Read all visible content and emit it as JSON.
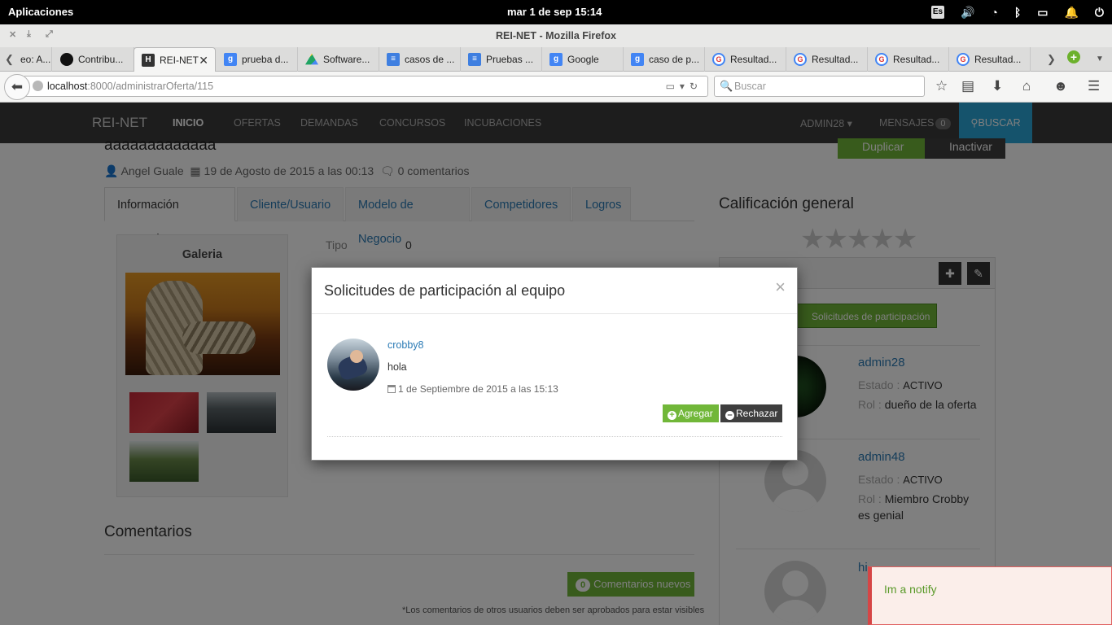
{
  "gnome": {
    "apps_label": "Aplicaciones",
    "clock": "mar  1 de sep    15:14",
    "lang": "Es"
  },
  "firefox": {
    "window_title": "REI-NET - Mozilla Firefox",
    "tabs": [
      {
        "label": "eo: A...",
        "icon": "tab-partial"
      },
      {
        "label": "Contribu...",
        "icon": "github-icon"
      },
      {
        "label": "REI-NET",
        "icon": "reinet-icon",
        "active": true
      },
      {
        "label": "prueba d...",
        "icon": "google-icon"
      },
      {
        "label": "Software...",
        "icon": "drive-icon"
      },
      {
        "label": "casos de ...",
        "icon": "docs-icon"
      },
      {
        "label": "Pruebas ...",
        "icon": "docs-icon"
      },
      {
        "label": "Google",
        "icon": "google-icon"
      },
      {
        "label": "caso de p...",
        "icon": "google-icon"
      },
      {
        "label": "Resultad...",
        "icon": "google-color-icon"
      },
      {
        "label": "Resultad...",
        "icon": "google-color-icon"
      },
      {
        "label": "Resultad...",
        "icon": "google-color-icon"
      },
      {
        "label": "Resultad...",
        "icon": "google-color-icon"
      }
    ],
    "url_host": "localhost",
    "url_rest": ":8000/administrarOferta/115",
    "search_placeholder": "Buscar"
  },
  "navbar": {
    "brand": "REI-NET",
    "links": [
      "INICIO",
      "OFERTAS",
      "DEMANDAS",
      "CONCURSOS",
      "INCUBACIONES"
    ],
    "user": "ADMIN28",
    "mensajes": "MENSAJES",
    "mensajes_count": "0",
    "buscar": "BUSCAR"
  },
  "offer": {
    "title": "aaaaaaaaaaaaa",
    "author": "Angel Guale",
    "date": "19 de Agosto de 2015 a las 00:13",
    "comments_count": "0 comentarios",
    "duplicar": "Duplicar",
    "inactivar": "Inactivar",
    "tabs": [
      "Información General",
      "Cliente/Usuario",
      "Modelo de Negocio",
      "Competidores",
      "Logros"
    ],
    "gallery_title": "Galeria",
    "tipo_label": "Tipo",
    "tipo_value": "0",
    "comentarios_title": "Comentarios",
    "comentarios_nuevos_count": "0",
    "comentarios_nuevos": "Comentarios nuevos",
    "comentarios_note": "*Los comentarios de otros usuarios deben ser aprobados para estar visibles"
  },
  "sidebar": {
    "calificacion_title": "Calificación general",
    "stars": "★★★★★",
    "solicitudes_btn": "Solicitudes de participación",
    "members": [
      {
        "name": "admin28",
        "estado_label": "Estado :",
        "estado": "ACTIVO",
        "rol_label": "Rol :",
        "rol": "dueño de la oferta"
      },
      {
        "name": "admin48",
        "estado_label": "Estado :",
        "estado": "ACTIVO",
        "rol_label": "Rol :",
        "rol": "Miembro Crobby",
        "rol2": "es genial"
      },
      {
        "name": "hi..."
      }
    ]
  },
  "modal": {
    "title": "Solicitudes de participación al equipo",
    "close": "×",
    "request": {
      "user": "crobby8",
      "message": "hola",
      "date": "1 de Septiembre de 2015 a las 15:13",
      "agregar": "Agregar",
      "rechazar": "Rechazar"
    }
  },
  "notify": {
    "text": "Im a notify"
  },
  "colors": {
    "accent_green": "#71b739",
    "link_blue": "#2a7ab5",
    "navbar_bg": "#3a3a3a",
    "search_blue": "#2aa6d8",
    "notify_border": "#d64545"
  }
}
